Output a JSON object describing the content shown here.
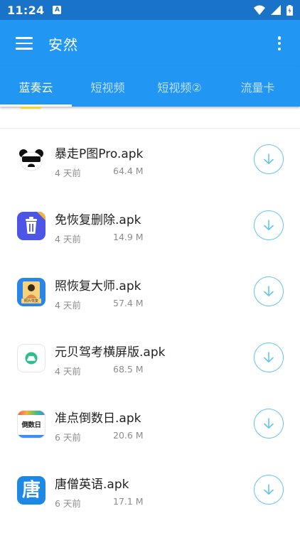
{
  "status_bar": {
    "time": "11:24",
    "badge": "A"
  },
  "app_bar": {
    "title": "安然"
  },
  "tabs": [
    "蓝奏云",
    "短视频",
    "短视频②",
    "流量卡"
  ],
  "files": [
    {
      "name": "暴走P图Pro.apk",
      "date": "4 天前",
      "size": "64.4 M",
      "icon": "panda-icon"
    },
    {
      "name": "免恢复删除.apk",
      "date": "4 天前",
      "size": "14.9 M",
      "icon": "trash-icon"
    },
    {
      "name": "照恢复大师.apk",
      "date": "4 天前",
      "size": "57.4 M",
      "icon": "photo-recovery-icon",
      "icon_text": "照片恢复"
    },
    {
      "name": "元贝驾考横屏版.apk",
      "date": "4 天前",
      "size": "68.5 M",
      "icon": "car-icon"
    },
    {
      "name": "准点倒数日.apk",
      "date": "6 天前",
      "size": "20.6 M",
      "icon": "countdown-icon",
      "icon_text": "倒数日"
    },
    {
      "name": "唐僧英语.apk",
      "date": "6 天前",
      "size": "17.1 M",
      "icon": "tangseng-icon",
      "icon_text": "唐"
    }
  ],
  "colors": {
    "primary": "#2196f3",
    "status_bar": "#1873c9",
    "download_accent": "#63c3f0"
  }
}
